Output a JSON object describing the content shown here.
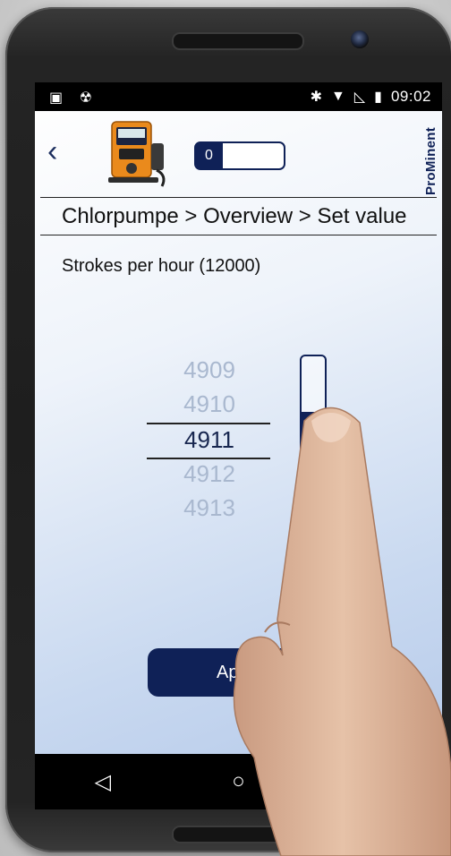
{
  "statusbar": {
    "left_icons": [
      "image-icon",
      "android-icon"
    ],
    "right_icons": [
      "bluetooth-icon",
      "wifi-icon",
      "signal-icon",
      "battery-icon"
    ],
    "time": "09:02"
  },
  "header": {
    "back_icon": "chevron-left-icon",
    "counter_value": "0",
    "brand": "ProMinent"
  },
  "breadcrumb": "Chlorpumpe > Overview > Set value",
  "field_label": "Strokes per hour (12000)",
  "picker": {
    "values": [
      "4909",
      "4910",
      "4911",
      "4912",
      "4913"
    ],
    "selected_index": 2,
    "slider_fraction": 0.41
  },
  "apply_label": "Apply",
  "navbar": {
    "back": "◁",
    "home": "○",
    "recents": "□"
  },
  "colors": {
    "accent": "#0f2157"
  }
}
